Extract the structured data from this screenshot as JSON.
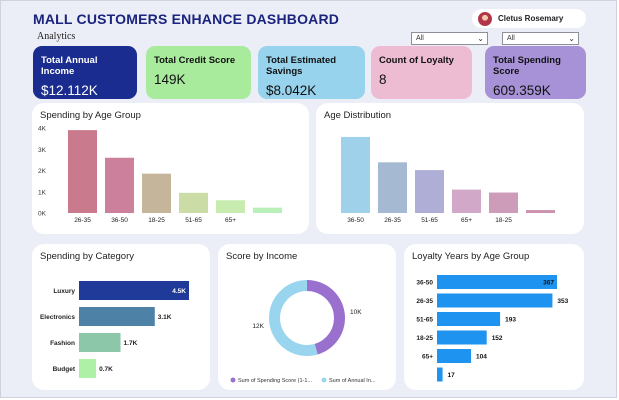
{
  "header": {
    "title": "MALL CUSTOMERS ENHANCE DASHBOARD",
    "subtitle": "Analytics",
    "user_name": "Cletus Rosemary"
  },
  "slicers": [
    {
      "value": "All"
    },
    {
      "value": "All"
    }
  ],
  "kpis": [
    {
      "label": "Total Annual Income",
      "value": "$12.112K",
      "bg": "#1a2c8f",
      "fg": "#ffffff"
    },
    {
      "label": "Total Credit Score",
      "value": "149K",
      "bg": "#a8eb9d",
      "fg": "#111111"
    },
    {
      "label": "Total Estimated Savings",
      "value": "$8.042K",
      "bg": "#97d3ec",
      "fg": "#111111"
    },
    {
      "label": "Count of Loyalty",
      "value": "8",
      "bg": "#eebcd2",
      "fg": "#111111"
    },
    {
      "label": "Total Spending Score",
      "value": "609.359K",
      "bg": "#a792d8",
      "fg": "#111111"
    }
  ],
  "chart_data": [
    {
      "id": "spending_by_age",
      "type": "bar",
      "title": "Spending by Age Group",
      "categories": [
        "26-35",
        "36-50",
        "18-25",
        "51-65",
        "65+",
        ""
      ],
      "values": [
        3900,
        2600,
        1850,
        950,
        600,
        250
      ],
      "ylim": [
        0,
        4000
      ],
      "yticks": [
        "0K",
        "1K",
        "2K",
        "3K",
        "4K"
      ],
      "colors": [
        "#c97a8c",
        "#cc809b",
        "#c4b59b",
        "#cbdca6",
        "#c8ebb0",
        "#b9efb8"
      ]
    },
    {
      "id": "age_distribution",
      "type": "bar",
      "title": "Age Distribution",
      "categories": [
        "36-50",
        "26-35",
        "51-65",
        "65+",
        "18-25",
        ""
      ],
      "values": [
        3.9,
        2.6,
        2.2,
        1.2,
        1.05,
        0.15
      ],
      "ylim": [
        0,
        4
      ],
      "colors": [
        "#9fd1ea",
        "#a6b9d3",
        "#aeaed6",
        "#d2a8c8",
        "#cc9cb8",
        "#cc92b0"
      ]
    },
    {
      "id": "spending_by_category",
      "type": "bar",
      "orientation": "horizontal",
      "title": "Spending by Category",
      "categories": [
        "Luxury",
        "Electronics",
        "Fashion",
        "Budget"
      ],
      "values": [
        4.5,
        3.1,
        1.7,
        0.7
      ],
      "labels": [
        "4.5K",
        "3.1K",
        "1.7K",
        "0.7K"
      ],
      "xlim": [
        0,
        4.5
      ],
      "colors": [
        "#1f3a99",
        "#4e81a6",
        "#8dc7a9",
        "#aef0a6"
      ]
    },
    {
      "id": "score_by_income",
      "type": "pie",
      "donut": true,
      "title": "Score by Income",
      "values": [
        10,
        12
      ],
      "labels": [
        "10K",
        "12K"
      ],
      "legend": [
        "Sum of Spending Score (1-1...",
        "Sum of Annual In..."
      ],
      "colors": [
        "#9a70cf",
        "#99d5ef"
      ],
      "legend_position": "bottom"
    },
    {
      "id": "loyalty_by_age",
      "type": "bar",
      "orientation": "horizontal",
      "title": "Loyalty Years by Age Group",
      "categories": [
        "36-50",
        "26-35",
        "51-65",
        "18-25",
        "65+",
        ""
      ],
      "values": [
        367,
        353,
        193,
        152,
        104,
        17
      ],
      "xlim": [
        0,
        367
      ],
      "color": "#1e93f0"
    }
  ]
}
